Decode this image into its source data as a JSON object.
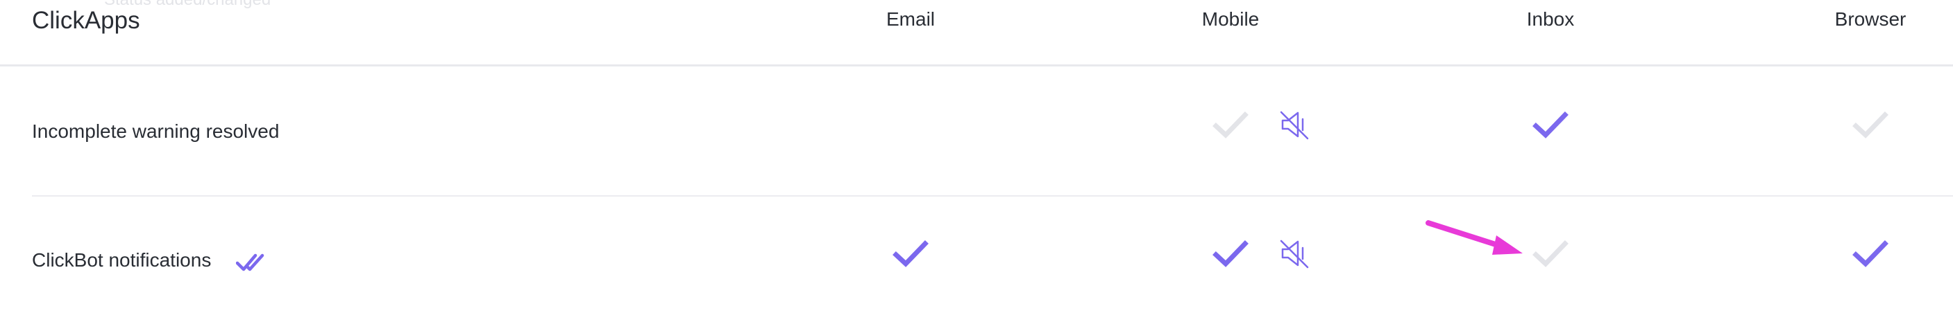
{
  "ghost_text": "Status added/changed",
  "section": {
    "title": "ClickApps"
  },
  "columns": [
    {
      "id": "email",
      "label": "Email"
    },
    {
      "id": "mobile",
      "label": "Mobile"
    },
    {
      "id": "inbox",
      "label": "Inbox"
    },
    {
      "id": "browser",
      "label": "Browser"
    }
  ],
  "rows": [
    {
      "label": "Incomplete warning resolved",
      "email": null,
      "mobile": false,
      "mobile_muted": true,
      "inbox": true,
      "browser": false
    },
    {
      "label": "ClickBot notifications",
      "label_icon": "double-check-icon",
      "email": true,
      "mobile": true,
      "mobile_muted": true,
      "inbox": false,
      "browser": true
    }
  ],
  "colors": {
    "checked": "#7b68ee",
    "unchecked": "#e3e4e8",
    "annotation_arrow": "#e83ad8",
    "divider": "#e8e9ed"
  }
}
